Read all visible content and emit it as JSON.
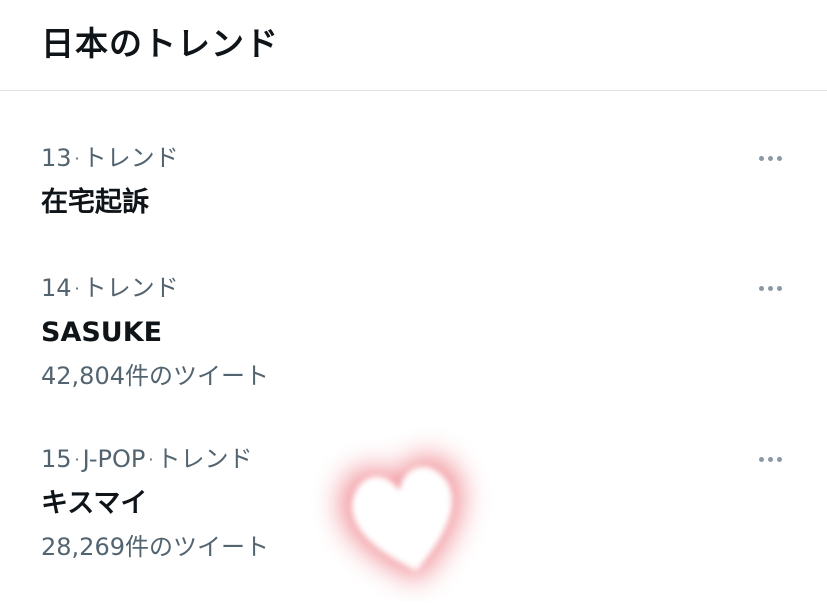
{
  "header": {
    "title": "日本のトレンド"
  },
  "trends": [
    {
      "rank": "13",
      "category": "",
      "context": "トレンド",
      "name": "在宅起訴",
      "count": ""
    },
    {
      "rank": "14",
      "category": "",
      "context": "トレンド",
      "name": "SASUKE",
      "count": "42,804件のツイート"
    },
    {
      "rank": "15",
      "category": "J-POP",
      "context": "トレンド",
      "name": "キスマイ",
      "count": "28,269件のツイート"
    }
  ],
  "icons": {
    "more": "more-horizontal-icon",
    "sticker": "heart-sticker"
  },
  "colors": {
    "text_primary": "#0f1419",
    "text_secondary": "#536471",
    "divider": "#dfe3e6",
    "heart_glow": "#e8505b"
  }
}
